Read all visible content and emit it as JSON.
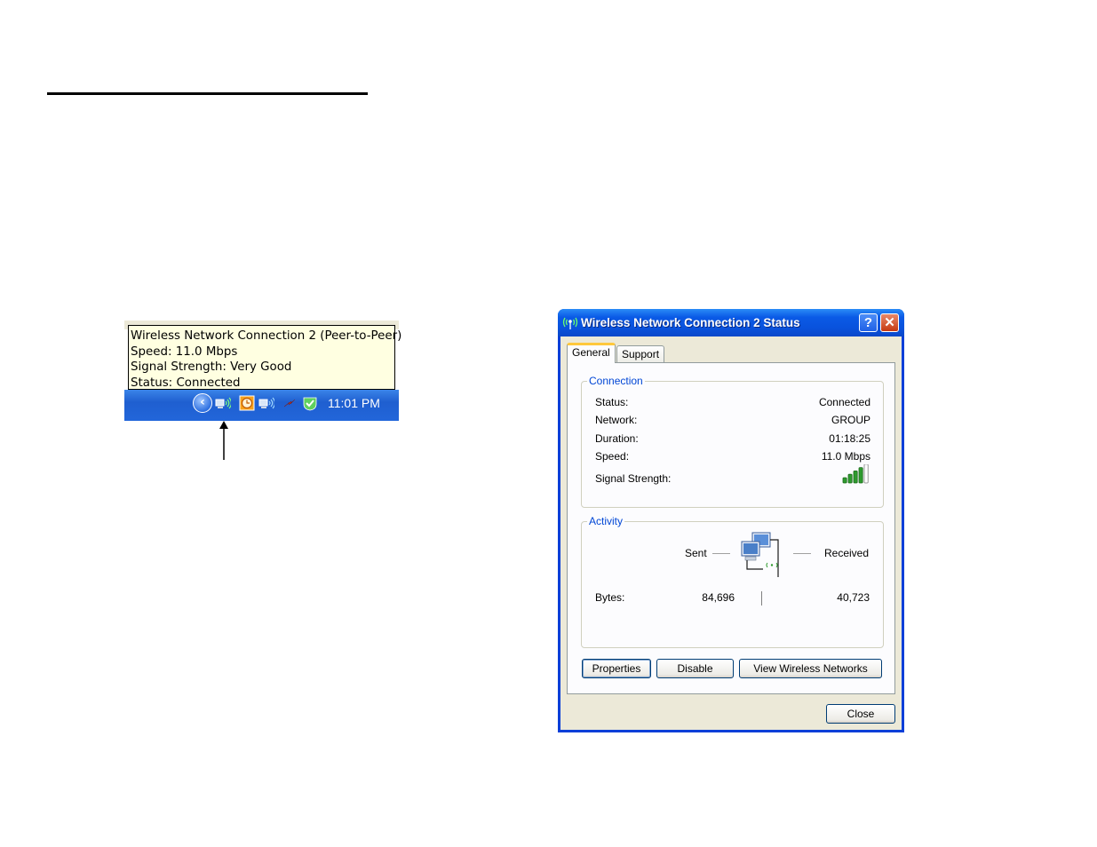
{
  "tooltip": {
    "lines": [
      "Wireless Network Connection 2 (Peer-to-Peer)",
      "Speed: 11.0 Mbps",
      "Signal Strength: Very Good",
      "Status: Connected"
    ]
  },
  "taskbar": {
    "clock": "11:01 PM",
    "tray_icons": [
      "show-hidden-icons-icon",
      "wireless-network-icon",
      "clock-app-icon",
      "wireless-network-icon",
      "power-icon",
      "security-check-icon"
    ]
  },
  "dialog": {
    "title": "Wireless Network Connection 2 Status",
    "help_label": "?",
    "close_label": "✕",
    "tabs": [
      {
        "label": "General",
        "active": true
      },
      {
        "label": "Support",
        "active": false
      }
    ],
    "connection": {
      "title": "Connection",
      "rows": [
        {
          "label": "Status:",
          "value": "Connected"
        },
        {
          "label": "Network:",
          "value": "GROUP"
        },
        {
          "label": "Duration:",
          "value": "01:18:25"
        },
        {
          "label": "Speed:",
          "value": "11.0 Mbps"
        },
        {
          "label": "Signal Strength:",
          "value": ""
        }
      ],
      "signal_bars_lit": 4,
      "signal_bars_total": 5
    },
    "activity": {
      "title": "Activity",
      "sent_label": "Sent",
      "received_label": "Received",
      "bytes_label": "Bytes:",
      "bytes_sent": "84,696",
      "bytes_received": "40,723"
    },
    "buttons": {
      "properties": "Properties",
      "disable": "Disable",
      "view_wireless": "View Wireless Networks",
      "close": "Close"
    }
  },
  "colors": {
    "titlebar": "#0a5ae6",
    "group_title": "#0046d5",
    "signal_green": "#2e9a2e",
    "tooltip_bg": "#ffffe1"
  }
}
